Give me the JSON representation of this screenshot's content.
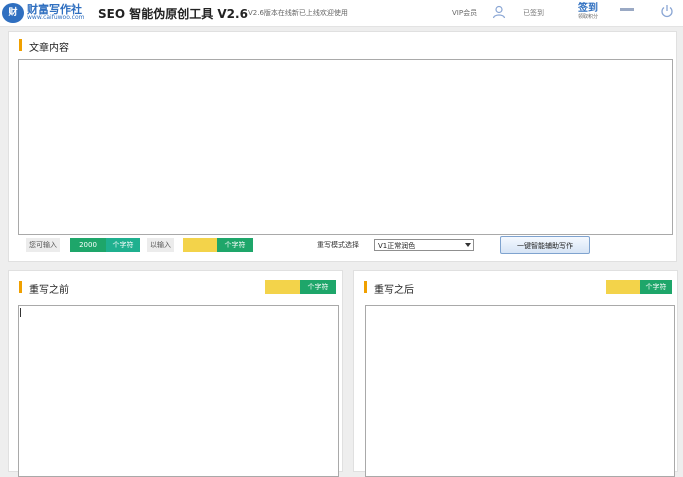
{
  "header": {
    "logo_badge": "财",
    "logo_name": "财富写作社",
    "logo_url": "www.caifuwoo.com",
    "app_title": "SEO 智能伪原创工具 V2.6",
    "notice": "V2.6版本在线新已上线欢迎使用",
    "vip_label": "VIP会员",
    "mini_label": "已签到",
    "checkin_label": "签到",
    "checkin_sub": "领取积分"
  },
  "article": {
    "title": "文章内容",
    "can_input_label": "您可输入",
    "can_input_value": "2000",
    "unit": "个字符",
    "entered_label": "以输入",
    "entered_value": "",
    "mode_label": "重写模式选择",
    "mode_selected": "V1正常润色",
    "rewrite_button": "一键智能辅助写作"
  },
  "before": {
    "title": "重写之前",
    "count_value": "",
    "unit": "个字符"
  },
  "after": {
    "title": "重写之后",
    "count_value": "",
    "unit": "个字符"
  },
  "colors": {
    "accent_blue": "#2f6fc0",
    "orange_mark": "#f0a000",
    "green": "#1ea66a",
    "teal": "#1fb08f",
    "yellow": "#f3d34a"
  }
}
